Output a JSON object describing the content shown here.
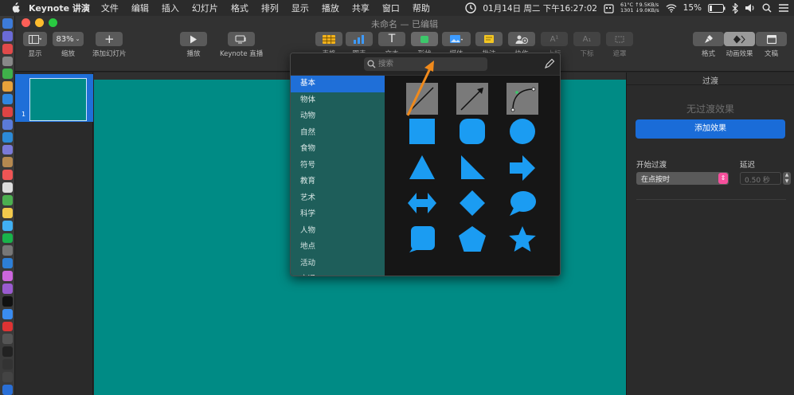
{
  "menubar": {
    "app": "Keynote 讲演",
    "items": [
      "文件",
      "编辑",
      "插入",
      "幻灯片",
      "格式",
      "排列",
      "显示",
      "播放",
      "共享",
      "窗口",
      "帮助"
    ],
    "status": {
      "datetime": "01月14日 周二 下午16:27:02",
      "temp": "61°C",
      "rpm": "1301",
      "up": "↑9.5KB/s",
      "down": "↓9.0KB/s",
      "battery": "15%"
    }
  },
  "window": {
    "title": "未命名 — 已编辑"
  },
  "toolbar": {
    "view_label": "显示",
    "zoom_value": "83%",
    "zoom_label": "缩放",
    "add_slide_label": "添加幻灯片",
    "play_label": "播放",
    "keynote_live_label": "Keynote 直播",
    "table_label": "表格",
    "chart_label": "图表",
    "text_label": "文本",
    "shape_label": "形状",
    "media_label": "媒体",
    "comment_label": "批注",
    "collaborate_label": "协作",
    "superscript_label": "上标",
    "subscript_label": "下标",
    "mask_label": "遮罩",
    "format_label": "格式",
    "animate_label": "动画效果",
    "document_label": "文稿"
  },
  "navigator": {
    "slide_number": "1"
  },
  "inspector": {
    "header": "过渡",
    "no_effect": "无过渡效果",
    "add_effect": "添加效果",
    "start_label": "开始过渡",
    "start_value": "在点按时",
    "delay_label": "延迟",
    "delay_value": "0.50 秒"
  },
  "shape_popover": {
    "search_placeholder": "搜索",
    "categories": [
      "基本",
      "物体",
      "动物",
      "自然",
      "食物",
      "符号",
      "教育",
      "艺术",
      "科学",
      "人物",
      "地点",
      "活动",
      "交通"
    ],
    "selected_category": "基本"
  },
  "colors": {
    "slide_bg": "#008b85",
    "shape_fill": "#1b9cf2",
    "accent": "#1f6fd8",
    "annotation_arrow": "#f08a1c",
    "category_bg": "#1e5e5a"
  }
}
